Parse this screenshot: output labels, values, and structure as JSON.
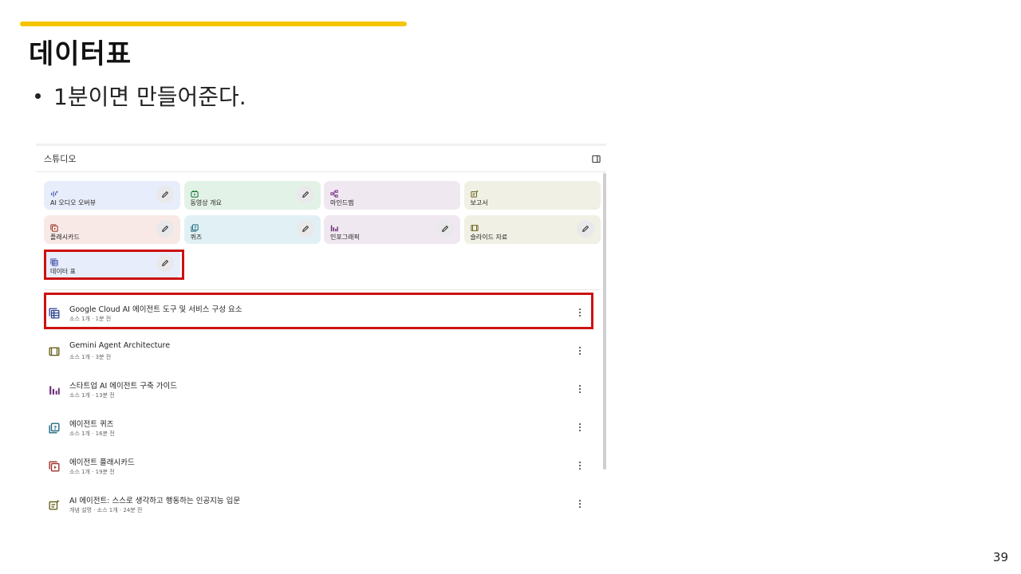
{
  "slide": {
    "title": "데이터표",
    "bullet": "1분이면 만들어준다.",
    "page_number": "39",
    "accent_color": "#f5c400",
    "highlight_color": "#cc1111"
  },
  "studio": {
    "title": "스튜디오",
    "collapse_icon": "panel-toggle-icon",
    "tiles": [
      {
        "label": "AI 오디오 오버뷰",
        "icon": "audio-waveform-icon",
        "color": "#e8edfb",
        "icon_color": "#3a4da8",
        "editable": true
      },
      {
        "label": "동영상 개요",
        "icon": "video-icon",
        "color": "#e3f2e6",
        "icon_color": "#1e7a3a",
        "editable": true
      },
      {
        "label": "마인드맵",
        "icon": "mindmap-icon",
        "color": "#f0e8f0",
        "icon_color": "#7a3a8a",
        "editable": false
      },
      {
        "label": "보고서",
        "icon": "report-icon",
        "color": "#f1f0e4",
        "icon_color": "#6a6320",
        "editable": false
      },
      {
        "label": "플래시카드",
        "icon": "flashcard-icon",
        "color": "#f8e9e6",
        "icon_color": "#a0322a",
        "editable": true
      },
      {
        "label": "퀴즈",
        "icon": "quiz-icon",
        "color": "#e1f0f4",
        "icon_color": "#1f6b80",
        "editable": true
      },
      {
        "label": "인포그래픽",
        "icon": "infographic-icon",
        "color": "#f0e8f0",
        "icon_color": "#6a2a7a",
        "editable": true
      },
      {
        "label": "슬라이드 자료",
        "icon": "slides-icon",
        "color": "#f1f0e4",
        "icon_color": "#6a6320",
        "editable": true
      },
      {
        "label": "데이터 표",
        "icon": "data-table-icon",
        "color": "#e8edfb",
        "icon_color": "#3a4da8",
        "editable": true
      }
    ],
    "items": [
      {
        "title": "Google Cloud AI 에이전트 도구 및 서비스 구성 요소",
        "subtitle": "소스 1개 · 1분 전",
        "icon": "data-table-icon",
        "icon_color": "#2a3f8f"
      },
      {
        "title": "Gemini Agent Architecture",
        "subtitle": "소스 1개 · 3분 전",
        "icon": "slides-icon",
        "icon_color": "#6a6320"
      },
      {
        "title": "스타트업 AI 에이전트 구축 가이드",
        "subtitle": "소스 1개 · 13분 전",
        "icon": "infographic-icon",
        "icon_color": "#6a2a7a"
      },
      {
        "title": "에이전트 퀴즈",
        "subtitle": "소스 1개 · 16분 전",
        "icon": "quiz-icon",
        "icon_color": "#1f6b80"
      },
      {
        "title": "에이전트 플래시카드",
        "subtitle": "소스 1개 · 19분 전",
        "icon": "flashcard-icon",
        "icon_color": "#a0322a"
      },
      {
        "title": "AI 에이전트: 스스로 생각하고 행동하는 인공지능 입문",
        "subtitle": "개념 설명 · 소스 1개 · 24분 전",
        "icon": "report-icon",
        "icon_color": "#6a6320"
      }
    ]
  }
}
